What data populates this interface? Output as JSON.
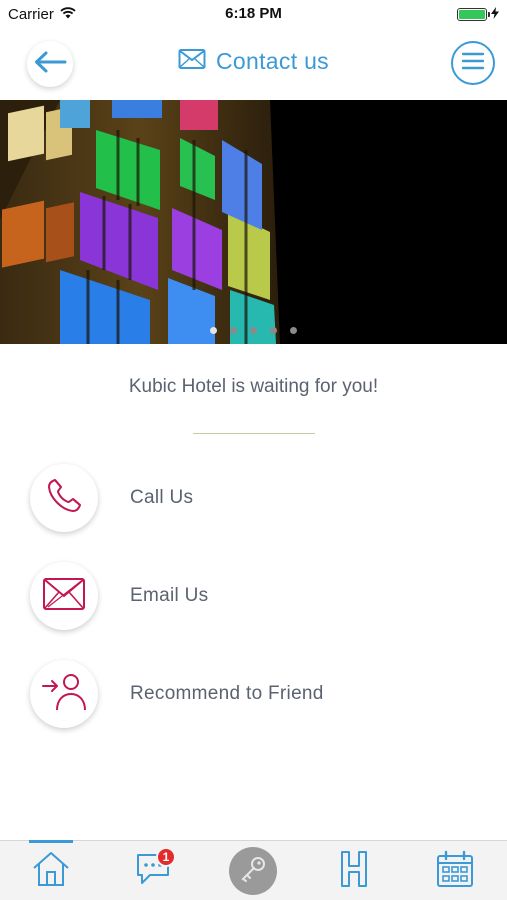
{
  "status_bar": {
    "carrier": "Carrier",
    "time": "6:18 PM",
    "battery_level": 1.0
  },
  "header": {
    "title": "Contact us",
    "back_icon": "arrow-left-icon",
    "title_icon": "envelope-icon",
    "menu_icon": "hamburger-menu-icon"
  },
  "hero": {
    "slide_count": 5,
    "active_slide": 1
  },
  "tagline": "Kubic Hotel is waiting for you!",
  "contacts": [
    {
      "label": "Call Us",
      "icon": "phone-icon"
    },
    {
      "label": "Email Us",
      "icon": "envelope-icon"
    },
    {
      "label": "Recommend to Friend",
      "icon": "recommend-friend-icon"
    }
  ],
  "tab_bar": {
    "tabs": [
      {
        "name": "home",
        "icon": "home-icon",
        "active": true
      },
      {
        "name": "messages",
        "icon": "chat-icon",
        "badge": "1"
      },
      {
        "name": "key",
        "icon": "key-icon"
      },
      {
        "name": "hotel",
        "icon": "hotel-h-icon"
      },
      {
        "name": "calendar",
        "icon": "calendar-icon"
      }
    ]
  },
  "colors": {
    "accent": "#3b9ad6",
    "contact_icon": "#c2184f",
    "badge": "#e32b2b",
    "divider": "#c9c7a4"
  }
}
